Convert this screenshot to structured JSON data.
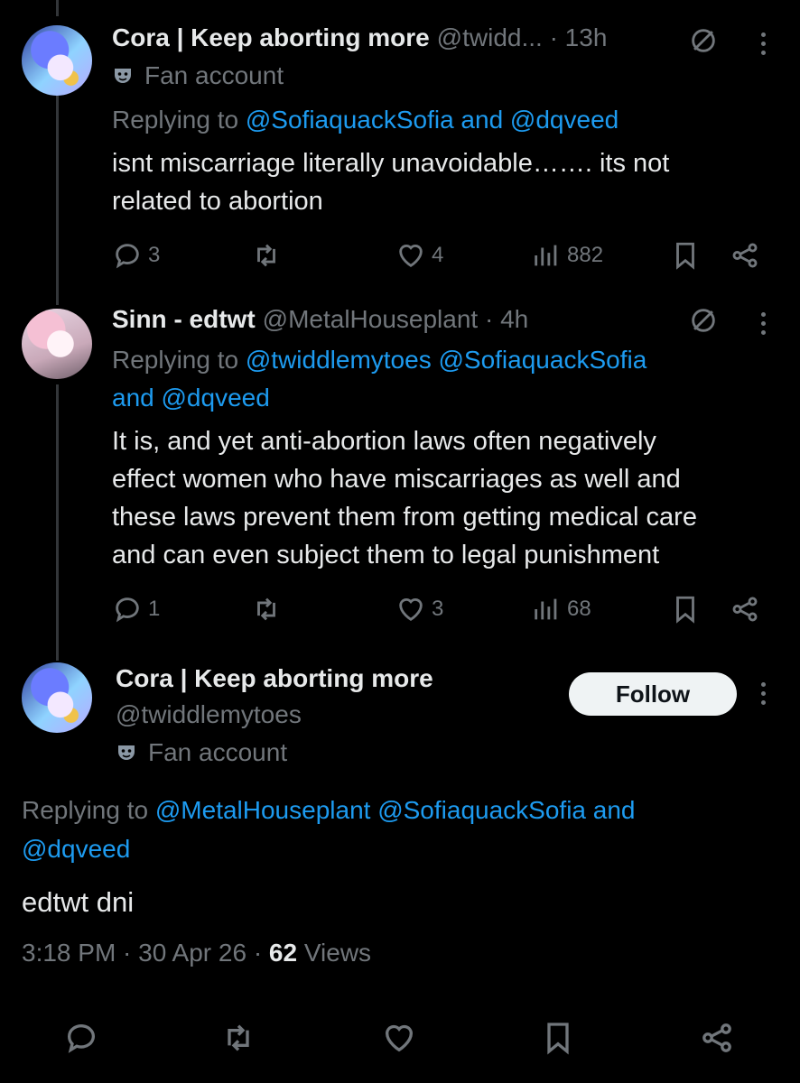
{
  "tweets": [
    {
      "display_name": "Cora | Keep aborting more",
      "handle_time": "@twidd... · 13h",
      "badge": "Fan account",
      "replying_prefix": "Replying to",
      "replying_links": "@SofiaquackSofia and @dqveed",
      "text_lines": [
        "isnt miscarriage literally unavoidable……. its not",
        "related to abortion"
      ],
      "replies": "3",
      "retweets": "",
      "likes": "4",
      "views": "882"
    },
    {
      "display_name": "Sinn - edtwt",
      "handle_time": "@MetalHouseplant · 4h",
      "replying_prefix": "Replying to",
      "replying_links_line1": "@twiddlemytoes @SofiaquackSofia",
      "replying_links_line2": "and @dqveed",
      "text_lines": [
        "It is, and yet anti-abortion laws often negatively",
        "effect women who have miscarriages as well and",
        "these laws prevent them from getting medical care",
        "and can even subject them to legal punishment"
      ],
      "replies": "1",
      "retweets": "",
      "likes": "3",
      "views": "68"
    }
  ],
  "main": {
    "display_name": "Cora | Keep aborting more",
    "handle": "@twiddlemytoes",
    "badge": "Fan account",
    "follow_label": "Follow",
    "replying_prefix": "Replying to",
    "replying_links_line1": "@MetalHouseplant @SofiaquackSofia and",
    "replying_links_line2": "@dqveed",
    "text": "edtwt dni",
    "timestamp": "3:18 PM · 30 Apr 26 · ",
    "views_count": "62",
    "views_label": " Views"
  },
  "icons": {
    "reply": "reply-icon",
    "retweet": "retweet-icon",
    "like": "heart-icon",
    "views": "views-icon",
    "bookmark": "bookmark-icon",
    "share": "share-icon",
    "muted": "muted-icon",
    "more": "more-icon",
    "badge": "mask-icon"
  },
  "colors": {
    "background": "#000000",
    "text": "#e7e9ea",
    "muted": "#71767b",
    "link": "#1d9bf0",
    "follow_bg": "#eff3f4"
  }
}
